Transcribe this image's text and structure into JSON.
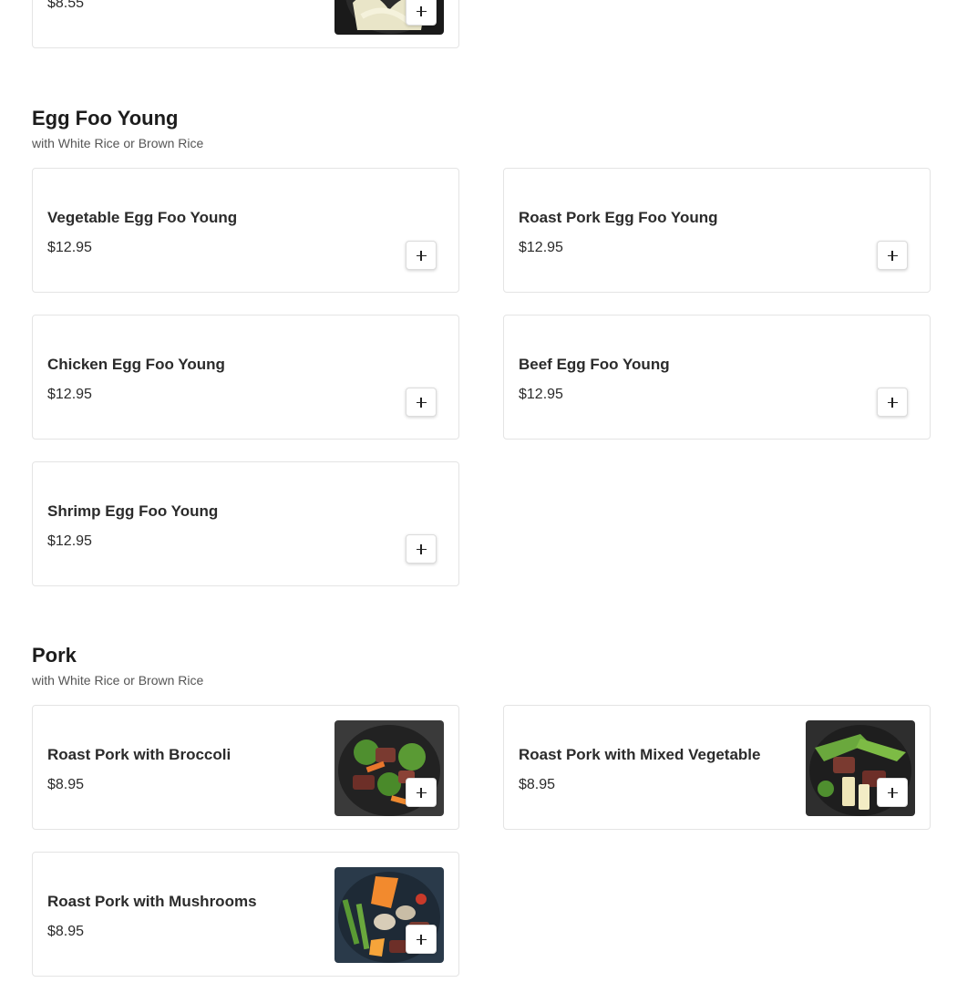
{
  "prev_section": {
    "items": [
      {
        "name": "",
        "price": "$8.55",
        "has_image": true
      }
    ]
  },
  "egg_foo_young": {
    "title": "Egg Foo Young",
    "subtitle": "with White Rice or Brown Rice",
    "items": [
      {
        "name": "Vegetable Egg Foo Young",
        "price": "$12.95"
      },
      {
        "name": "Roast Pork Egg Foo Young",
        "price": "$12.95"
      },
      {
        "name": "Chicken Egg Foo Young",
        "price": "$12.95"
      },
      {
        "name": "Beef Egg Foo Young",
        "price": "$12.95"
      },
      {
        "name": "Shrimp Egg Foo Young",
        "price": "$12.95"
      }
    ]
  },
  "pork": {
    "title": "Pork",
    "subtitle": "with White Rice or Brown Rice",
    "items": [
      {
        "name": "Roast Pork with Broccoli",
        "price": "$8.95",
        "has_image": true
      },
      {
        "name": "Roast Pork with Mixed Vegetable",
        "price": "$8.95",
        "has_image": true
      },
      {
        "name": "Roast Pork with Mushrooms",
        "price": "$8.95",
        "has_image": true
      }
    ]
  },
  "icons": {
    "add": "plus-icon"
  }
}
